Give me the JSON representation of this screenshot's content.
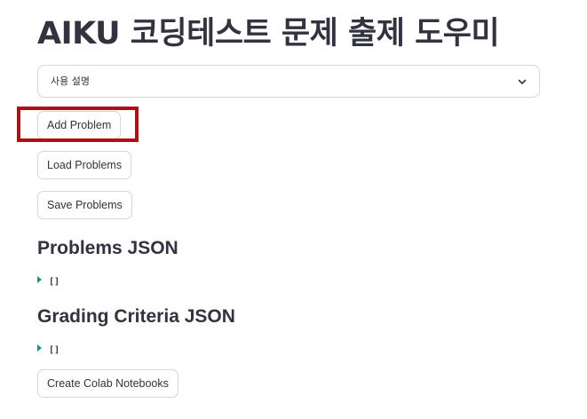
{
  "header": {
    "title": "AIKU 코딩테스트 문제 출제 도우미"
  },
  "usage_expander": {
    "label": "사용 설명",
    "icon": "chevron-down-icon"
  },
  "buttons": {
    "add_problem": "Add Problem",
    "load_problems": "Load Problems",
    "save_problems": "Save Problems",
    "create_colab": "Create Colab Notebooks"
  },
  "highlight": {
    "color": "#b30e14",
    "target": "add_problem"
  },
  "problems_section": {
    "title": "Problems JSON",
    "value": "[]"
  },
  "grading_section": {
    "title": "Grading Criteria JSON",
    "value": "[]"
  },
  "colors": {
    "text": "#31333f",
    "border": "#d6d6d9",
    "caret": "#1f8f87"
  }
}
